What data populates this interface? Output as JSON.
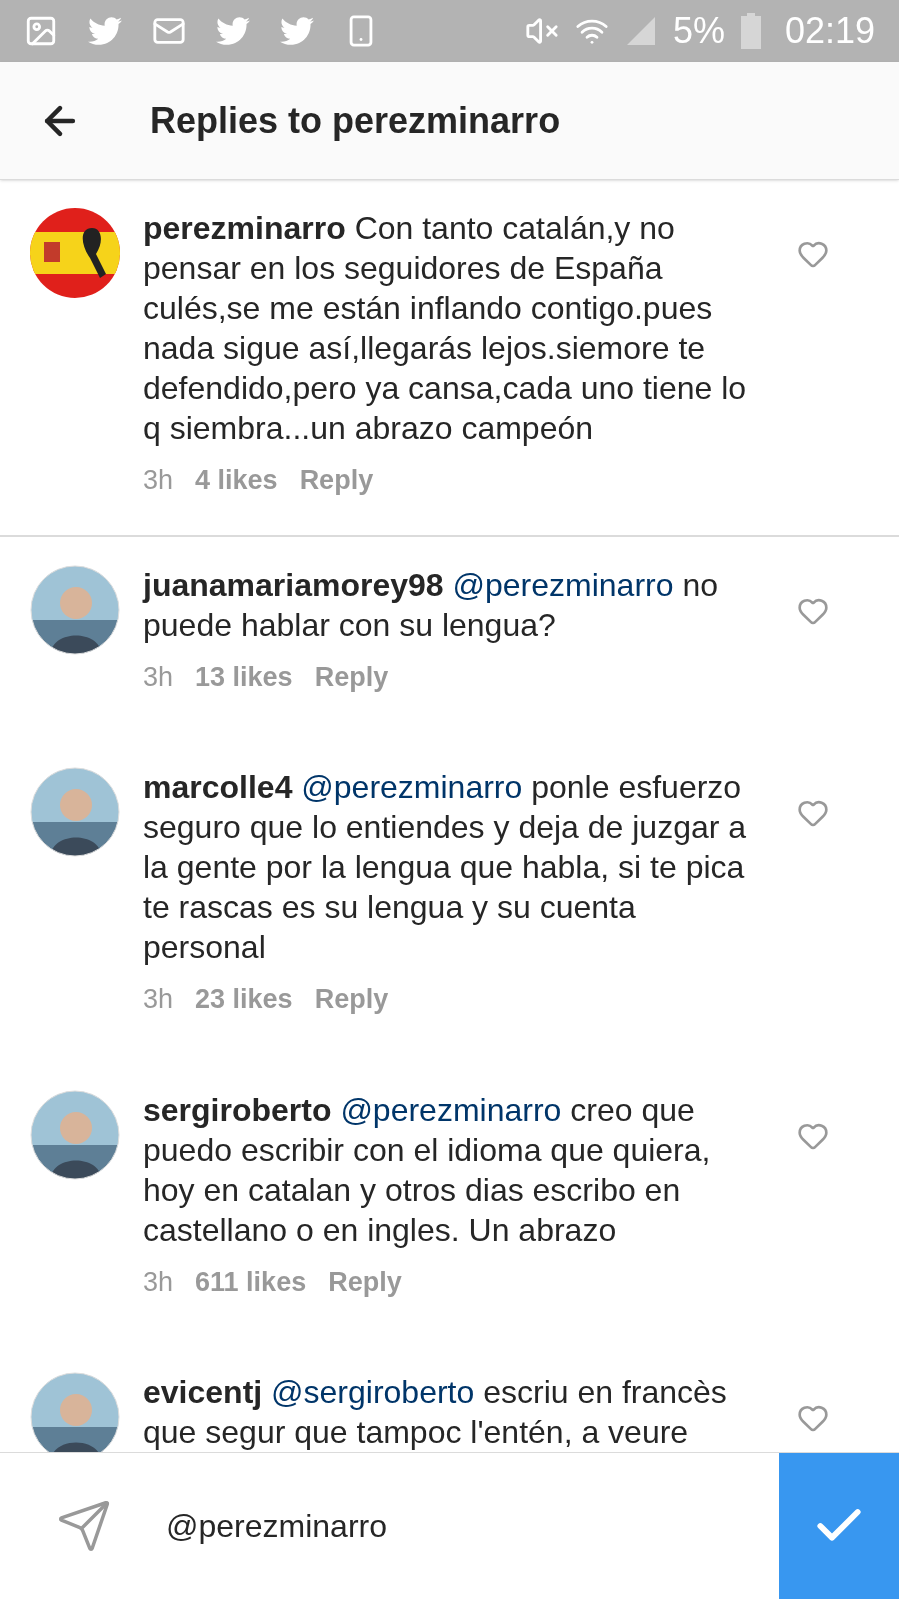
{
  "status_bar": {
    "battery": "5%",
    "time": "02:19"
  },
  "header": {
    "title": "Replies to perezminarro"
  },
  "comments": [
    {
      "avatar": {
        "kind": "flag"
      },
      "user": "perezminarro",
      "text": "Con tanto catalán,y no pensar en los seguidores de España culés,se me  están inflando contigo.pues nada sigue así,llegarás lejos.siemore te defendido,pero ya cansa,cada uno tiene lo q siembra...un abrazo campeón",
      "time": "3h",
      "likes": "4 likes",
      "reply": "Reply",
      "liked": false,
      "divider_after": true
    },
    {
      "user": "juanamariamorey98",
      "mention": "@perezminarro",
      "text": "no puede hablar con su lengua?",
      "time": "3h",
      "likes": "13 likes",
      "reply": "Reply",
      "liked": false,
      "divider_after": false
    },
    {
      "user": "marcolle4",
      "mention": "@perezminarro",
      "text": "ponle esfuerzo seguro que lo entiendes y deja de juzgar a la gente por la lengua que habla, si te pica te rascas es su lengua y su cuenta personal",
      "time": "3h",
      "likes": "23 likes",
      "reply": "Reply",
      "liked": false,
      "divider_after": false
    },
    {
      "user": "sergiroberto",
      "mention": "@perezminarro",
      "text": "creo que puedo escribir con el idioma que quiera, hoy en catalan y otros dias escribo en castellano o en ingles. Un abrazo",
      "time": "3h",
      "likes": "611 likes",
      "reply": "Reply",
      "liked": false,
      "divider_after": false
    },
    {
      "user": "evicentj",
      "mention": "@sergiroberto",
      "text": "escriu en francès que segur que tampoc l'entén, a veure",
      "liked": false
    }
  ],
  "composer": {
    "value": "@perezminarro"
  }
}
